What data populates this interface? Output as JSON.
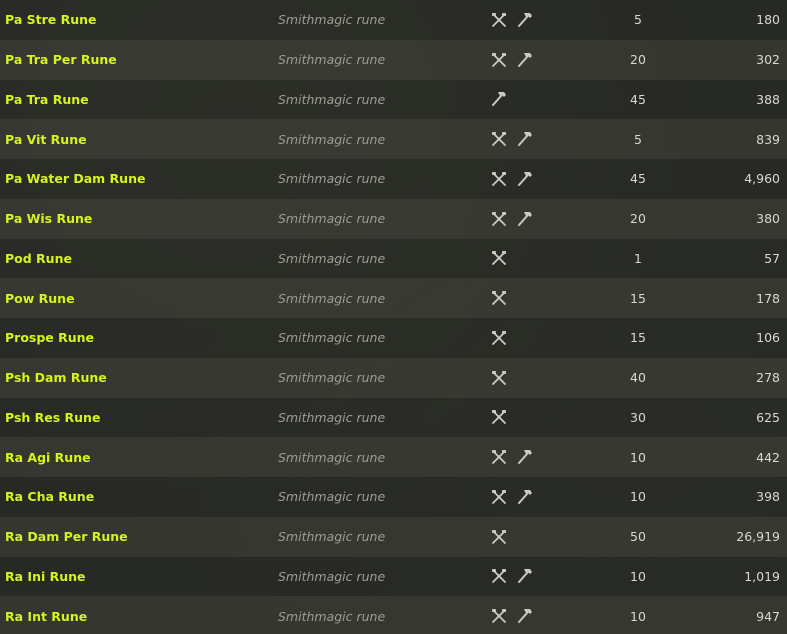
{
  "table": {
    "rows": [
      {
        "name": "Pa Stre Rune",
        "type": "Smithmagic rune",
        "icons": [
          "craft-icon",
          "hammer-icon"
        ],
        "level": "5",
        "price": "180"
      },
      {
        "name": "Pa Tra Per Rune",
        "type": "Smithmagic rune",
        "icons": [
          "craft-icon",
          "hammer-icon"
        ],
        "level": "20",
        "price": "302"
      },
      {
        "name": "Pa Tra Rune",
        "type": "Smithmagic rune",
        "icons": [
          "hammer-icon"
        ],
        "level": "45",
        "price": "388"
      },
      {
        "name": "Pa Vit Rune",
        "type": "Smithmagic rune",
        "icons": [
          "craft-icon",
          "hammer-icon"
        ],
        "level": "5",
        "price": "839"
      },
      {
        "name": "Pa Water Dam Rune",
        "type": "Smithmagic rune",
        "icons": [
          "craft-icon",
          "hammer-icon"
        ],
        "level": "45",
        "price": "4,960"
      },
      {
        "name": "Pa Wis Rune",
        "type": "Smithmagic rune",
        "icons": [
          "craft-icon",
          "hammer-icon"
        ],
        "level": "20",
        "price": "380"
      },
      {
        "name": "Pod Rune",
        "type": "Smithmagic rune",
        "icons": [
          "craft-icon"
        ],
        "level": "1",
        "price": "57"
      },
      {
        "name": "Pow Rune",
        "type": "Smithmagic rune",
        "icons": [
          "craft-icon"
        ],
        "level": "15",
        "price": "178"
      },
      {
        "name": "Prospe Rune",
        "type": "Smithmagic rune",
        "icons": [
          "craft-icon"
        ],
        "level": "15",
        "price": "106"
      },
      {
        "name": "Psh Dam Rune",
        "type": "Smithmagic rune",
        "icons": [
          "craft-icon"
        ],
        "level": "40",
        "price": "278"
      },
      {
        "name": "Psh Res Rune",
        "type": "Smithmagic rune",
        "icons": [
          "craft-icon"
        ],
        "level": "30",
        "price": "625"
      },
      {
        "name": "Ra Agi Rune",
        "type": "Smithmagic rune",
        "icons": [
          "craft-icon",
          "hammer-icon"
        ],
        "level": "10",
        "price": "442"
      },
      {
        "name": "Ra Cha Rune",
        "type": "Smithmagic rune",
        "icons": [
          "craft-icon",
          "hammer-icon"
        ],
        "level": "10",
        "price": "398"
      },
      {
        "name": "Ra Dam Per Rune",
        "type": "Smithmagic rune",
        "icons": [
          "craft-icon"
        ],
        "level": "50",
        "price": "26,919"
      },
      {
        "name": "Ra Ini Rune",
        "type": "Smithmagic rune",
        "icons": [
          "craft-icon",
          "hammer-icon"
        ],
        "level": "10",
        "price": "1,019"
      },
      {
        "name": "Ra Int Rune",
        "type": "Smithmagic rune",
        "icons": [
          "craft-icon",
          "hammer-icon"
        ],
        "level": "10",
        "price": "947"
      }
    ]
  },
  "colors": {
    "name_accent": "#d6f31c",
    "type_text": "#9c9d95",
    "value_text": "#d8d8d2",
    "icon_color": "#c9cac3"
  }
}
